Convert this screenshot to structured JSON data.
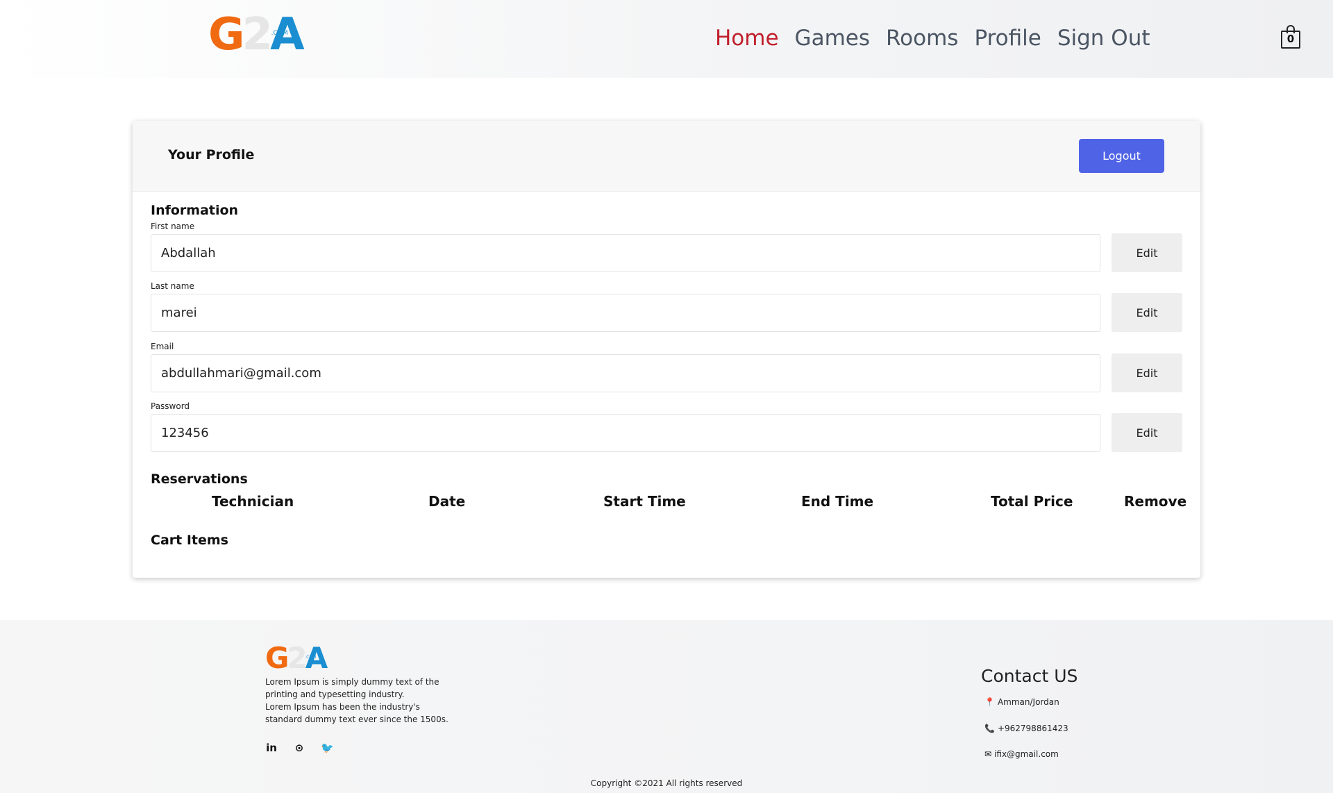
{
  "header": {
    "logo": {
      "g": "G",
      "two": "2",
      "a": "A",
      "com": ".COM"
    },
    "nav": [
      "Home",
      "Games",
      "Rooms",
      "Profile",
      "Sign Out"
    ],
    "cart_count": "0"
  },
  "profile": {
    "title": "Your Profile",
    "logout_label": "Logout",
    "information_title": "Information",
    "fields": [
      {
        "label": "First name",
        "value": "Abdallah"
      },
      {
        "label": "Last name",
        "value": "marei"
      },
      {
        "label": "Email",
        "value": "abdullahmari@gmail.com"
      },
      {
        "label": "Password",
        "value": "123456"
      }
    ],
    "edit_label": "Edit",
    "reservations_title": "Reservations",
    "reservations_columns": [
      "Technician",
      "Date",
      "Start Time",
      "End Time",
      "Total Price",
      "Remove"
    ],
    "cart_items_title": "Cart Items"
  },
  "footer": {
    "description": [
      "Lorem Ipsum is simply dummy text of the",
      "printing and typesetting industry.",
      "Lorem Ipsum has been the industry's",
      "standard dummy text ever since the 1500s."
    ],
    "socials": [
      "in",
      "⊙",
      "🐦"
    ],
    "contact_title": "Contact US",
    "contact": {
      "location": "Amman/Jordan",
      "phone": "+962798861423",
      "email": "ifix@gmail.com"
    },
    "copyright": "Copyright ©2021 All rights reserved"
  }
}
